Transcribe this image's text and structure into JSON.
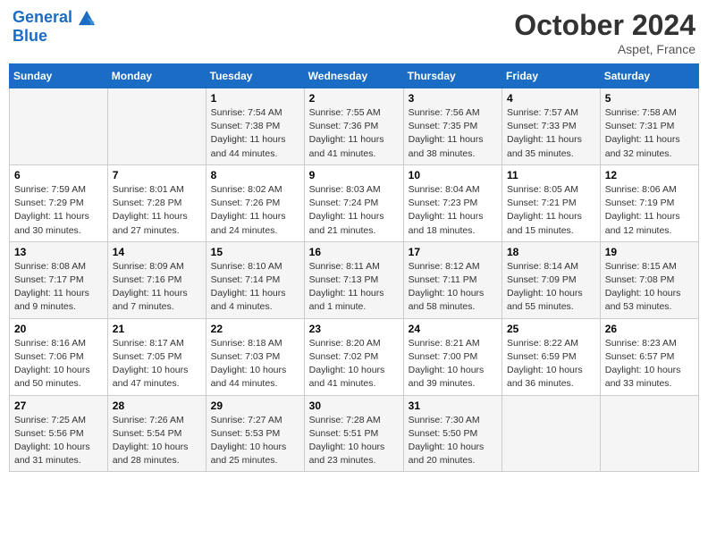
{
  "header": {
    "logo_line1": "General",
    "logo_line2": "Blue",
    "month": "October 2024",
    "location": "Aspet, France"
  },
  "weekdays": [
    "Sunday",
    "Monday",
    "Tuesday",
    "Wednesday",
    "Thursday",
    "Friday",
    "Saturday"
  ],
  "weeks": [
    [
      {
        "day": "",
        "sunrise": "",
        "sunset": "",
        "daylight": ""
      },
      {
        "day": "",
        "sunrise": "",
        "sunset": "",
        "daylight": ""
      },
      {
        "day": "1",
        "sunrise": "Sunrise: 7:54 AM",
        "sunset": "Sunset: 7:38 PM",
        "daylight": "Daylight: 11 hours and 44 minutes."
      },
      {
        "day": "2",
        "sunrise": "Sunrise: 7:55 AM",
        "sunset": "Sunset: 7:36 PM",
        "daylight": "Daylight: 11 hours and 41 minutes."
      },
      {
        "day": "3",
        "sunrise": "Sunrise: 7:56 AM",
        "sunset": "Sunset: 7:35 PM",
        "daylight": "Daylight: 11 hours and 38 minutes."
      },
      {
        "day": "4",
        "sunrise": "Sunrise: 7:57 AM",
        "sunset": "Sunset: 7:33 PM",
        "daylight": "Daylight: 11 hours and 35 minutes."
      },
      {
        "day": "5",
        "sunrise": "Sunrise: 7:58 AM",
        "sunset": "Sunset: 7:31 PM",
        "daylight": "Daylight: 11 hours and 32 minutes."
      }
    ],
    [
      {
        "day": "6",
        "sunrise": "Sunrise: 7:59 AM",
        "sunset": "Sunset: 7:29 PM",
        "daylight": "Daylight: 11 hours and 30 minutes."
      },
      {
        "day": "7",
        "sunrise": "Sunrise: 8:01 AM",
        "sunset": "Sunset: 7:28 PM",
        "daylight": "Daylight: 11 hours and 27 minutes."
      },
      {
        "day": "8",
        "sunrise": "Sunrise: 8:02 AM",
        "sunset": "Sunset: 7:26 PM",
        "daylight": "Daylight: 11 hours and 24 minutes."
      },
      {
        "day": "9",
        "sunrise": "Sunrise: 8:03 AM",
        "sunset": "Sunset: 7:24 PM",
        "daylight": "Daylight: 11 hours and 21 minutes."
      },
      {
        "day": "10",
        "sunrise": "Sunrise: 8:04 AM",
        "sunset": "Sunset: 7:23 PM",
        "daylight": "Daylight: 11 hours and 18 minutes."
      },
      {
        "day": "11",
        "sunrise": "Sunrise: 8:05 AM",
        "sunset": "Sunset: 7:21 PM",
        "daylight": "Daylight: 11 hours and 15 minutes."
      },
      {
        "day": "12",
        "sunrise": "Sunrise: 8:06 AM",
        "sunset": "Sunset: 7:19 PM",
        "daylight": "Daylight: 11 hours and 12 minutes."
      }
    ],
    [
      {
        "day": "13",
        "sunrise": "Sunrise: 8:08 AM",
        "sunset": "Sunset: 7:17 PM",
        "daylight": "Daylight: 11 hours and 9 minutes."
      },
      {
        "day": "14",
        "sunrise": "Sunrise: 8:09 AM",
        "sunset": "Sunset: 7:16 PM",
        "daylight": "Daylight: 11 hours and 7 minutes."
      },
      {
        "day": "15",
        "sunrise": "Sunrise: 8:10 AM",
        "sunset": "Sunset: 7:14 PM",
        "daylight": "Daylight: 11 hours and 4 minutes."
      },
      {
        "day": "16",
        "sunrise": "Sunrise: 8:11 AM",
        "sunset": "Sunset: 7:13 PM",
        "daylight": "Daylight: 11 hours and 1 minute."
      },
      {
        "day": "17",
        "sunrise": "Sunrise: 8:12 AM",
        "sunset": "Sunset: 7:11 PM",
        "daylight": "Daylight: 10 hours and 58 minutes."
      },
      {
        "day": "18",
        "sunrise": "Sunrise: 8:14 AM",
        "sunset": "Sunset: 7:09 PM",
        "daylight": "Daylight: 10 hours and 55 minutes."
      },
      {
        "day": "19",
        "sunrise": "Sunrise: 8:15 AM",
        "sunset": "Sunset: 7:08 PM",
        "daylight": "Daylight: 10 hours and 53 minutes."
      }
    ],
    [
      {
        "day": "20",
        "sunrise": "Sunrise: 8:16 AM",
        "sunset": "Sunset: 7:06 PM",
        "daylight": "Daylight: 10 hours and 50 minutes."
      },
      {
        "day": "21",
        "sunrise": "Sunrise: 8:17 AM",
        "sunset": "Sunset: 7:05 PM",
        "daylight": "Daylight: 10 hours and 47 minutes."
      },
      {
        "day": "22",
        "sunrise": "Sunrise: 8:18 AM",
        "sunset": "Sunset: 7:03 PM",
        "daylight": "Daylight: 10 hours and 44 minutes."
      },
      {
        "day": "23",
        "sunrise": "Sunrise: 8:20 AM",
        "sunset": "Sunset: 7:02 PM",
        "daylight": "Daylight: 10 hours and 41 minutes."
      },
      {
        "day": "24",
        "sunrise": "Sunrise: 8:21 AM",
        "sunset": "Sunset: 7:00 PM",
        "daylight": "Daylight: 10 hours and 39 minutes."
      },
      {
        "day": "25",
        "sunrise": "Sunrise: 8:22 AM",
        "sunset": "Sunset: 6:59 PM",
        "daylight": "Daylight: 10 hours and 36 minutes."
      },
      {
        "day": "26",
        "sunrise": "Sunrise: 8:23 AM",
        "sunset": "Sunset: 6:57 PM",
        "daylight": "Daylight: 10 hours and 33 minutes."
      }
    ],
    [
      {
        "day": "27",
        "sunrise": "Sunrise: 7:25 AM",
        "sunset": "Sunset: 5:56 PM",
        "daylight": "Daylight: 10 hours and 31 minutes."
      },
      {
        "day": "28",
        "sunrise": "Sunrise: 7:26 AM",
        "sunset": "Sunset: 5:54 PM",
        "daylight": "Daylight: 10 hours and 28 minutes."
      },
      {
        "day": "29",
        "sunrise": "Sunrise: 7:27 AM",
        "sunset": "Sunset: 5:53 PM",
        "daylight": "Daylight: 10 hours and 25 minutes."
      },
      {
        "day": "30",
        "sunrise": "Sunrise: 7:28 AM",
        "sunset": "Sunset: 5:51 PM",
        "daylight": "Daylight: 10 hours and 23 minutes."
      },
      {
        "day": "31",
        "sunrise": "Sunrise: 7:30 AM",
        "sunset": "Sunset: 5:50 PM",
        "daylight": "Daylight: 10 hours and 20 minutes."
      },
      {
        "day": "",
        "sunrise": "",
        "sunset": "",
        "daylight": ""
      },
      {
        "day": "",
        "sunrise": "",
        "sunset": "",
        "daylight": ""
      }
    ]
  ]
}
